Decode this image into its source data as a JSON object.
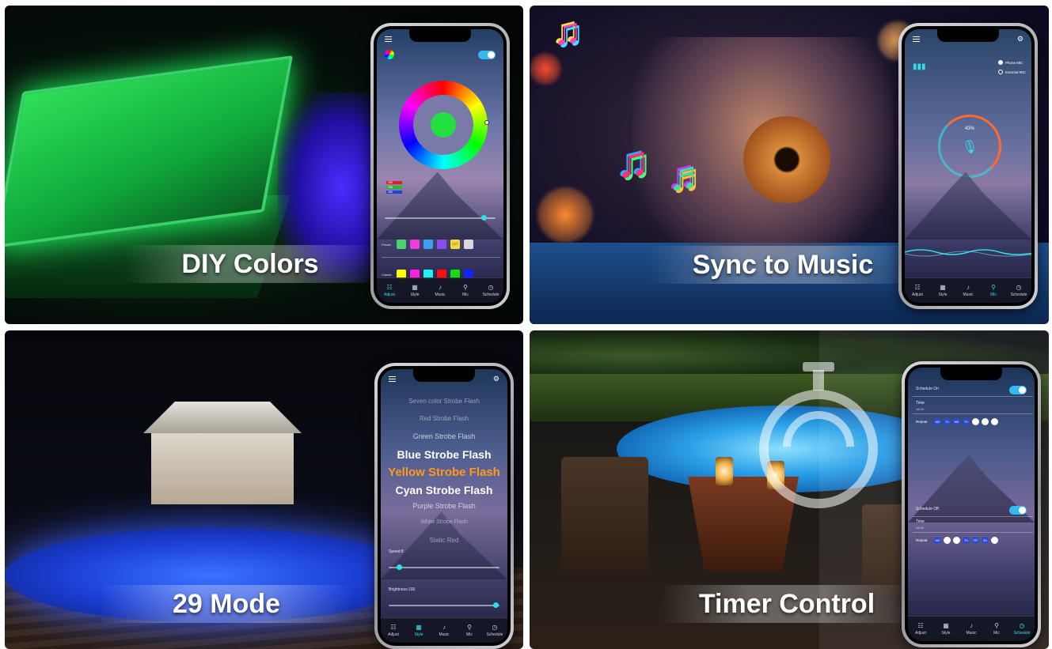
{
  "tiles": {
    "diy": {
      "caption": "DIY Colors"
    },
    "music": {
      "caption": "Sync to Music"
    },
    "modes": {
      "caption": "29 Mode"
    },
    "timer": {
      "caption": "Timer Control"
    }
  },
  "tabbar": [
    "Adjust",
    "Style",
    "Music",
    "Mic",
    "Schedule"
  ],
  "diy_phone": {
    "rgb_labels": [
      "255",
      "255",
      "255"
    ],
    "preset_label": "Preset",
    "preset_swatches": [
      "#4bd36a",
      "#ef3ed8",
      "#3aa0f0",
      "#8a4ef0",
      "#f4d83a",
      "#d8d8d8"
    ],
    "preset_cct": "CCT",
    "classic_label": "Classic",
    "classic_swatches": [
      "#ffff00",
      "#ff20e0",
      "#20f0f0",
      "#ff1010",
      "#10e010",
      "#1020ff"
    ]
  },
  "music_phone": {
    "phone_mic": "Phone MIC",
    "external_mic": "External MIC",
    "percent": "43%"
  },
  "modes_phone": {
    "modes": [
      "Seven color Strobe Flash",
      "Red Strobe Flash",
      "Green Strobe Flash",
      "Blue Strobe Flash",
      "Yellow Strobe Flash",
      "Cyan Strobe Flash",
      "Purple Strobe Flash",
      "White Strobe Flash",
      "Static Red"
    ],
    "speed_label": "Speed:8",
    "brightness_label": "Brightness:100"
  },
  "timer_phone": {
    "schedule_on": "Schedule On",
    "schedule_off": "Schedule Off",
    "time_label": "Time",
    "time_on": "18:00",
    "time_off": "06:00",
    "repeat_label": "Repeat",
    "days": [
      "MO",
      "TU",
      "WE",
      "TH",
      "FR",
      "SA",
      "SU"
    ]
  },
  "colors": {
    "accent": "#2ee0e6",
    "mode_selected": "#ff9a1e",
    "pool_green": "#2fe05a",
    "pool_blue": "#3a74ff"
  }
}
